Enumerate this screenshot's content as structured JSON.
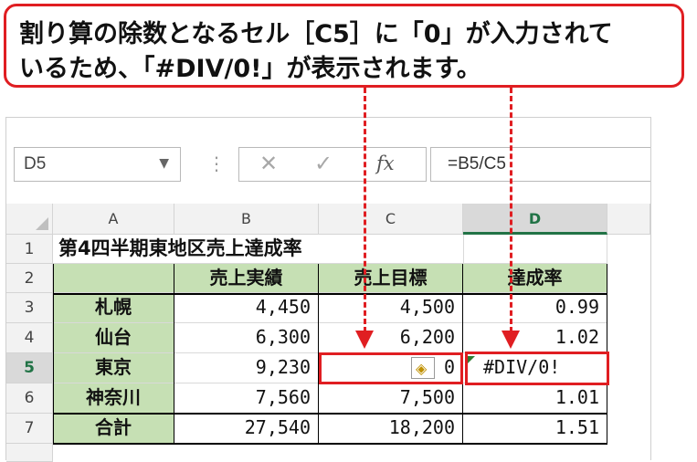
{
  "callout": {
    "line1": "割り算の除数となるセル［C5］に「0」が入力されて",
    "line2": "いるため、「#DIV/0!」が表示されます。"
  },
  "formula_bar": {
    "name_box": "D5",
    "fx_label": "fx",
    "formula": "=B5/C5"
  },
  "columns": [
    "A",
    "B",
    "C",
    "D"
  ],
  "rows": [
    "1",
    "2",
    "3",
    "4",
    "5",
    "6",
    "7"
  ],
  "sheet": {
    "title": "第4四半期東地区売上達成率",
    "headers": [
      "",
      "売上実績",
      "売上目標",
      "達成率"
    ],
    "data": [
      [
        "札幌",
        "4,450",
        "4,500",
        "0.99"
      ],
      [
        "仙台",
        "6,300",
        "6,200",
        "1.02"
      ],
      [
        "東京",
        "9,230",
        "0",
        "#DIV/0!"
      ],
      [
        "神奈川",
        "7,560",
        "7,500",
        "1.01"
      ],
      [
        "合計",
        "27,540",
        "18,200",
        "1.51"
      ]
    ]
  },
  "selected_cell": "D5",
  "colors": {
    "header_fill": "#c6e0b4",
    "selected_col": "#217346",
    "callout_border": "#e01e22"
  }
}
